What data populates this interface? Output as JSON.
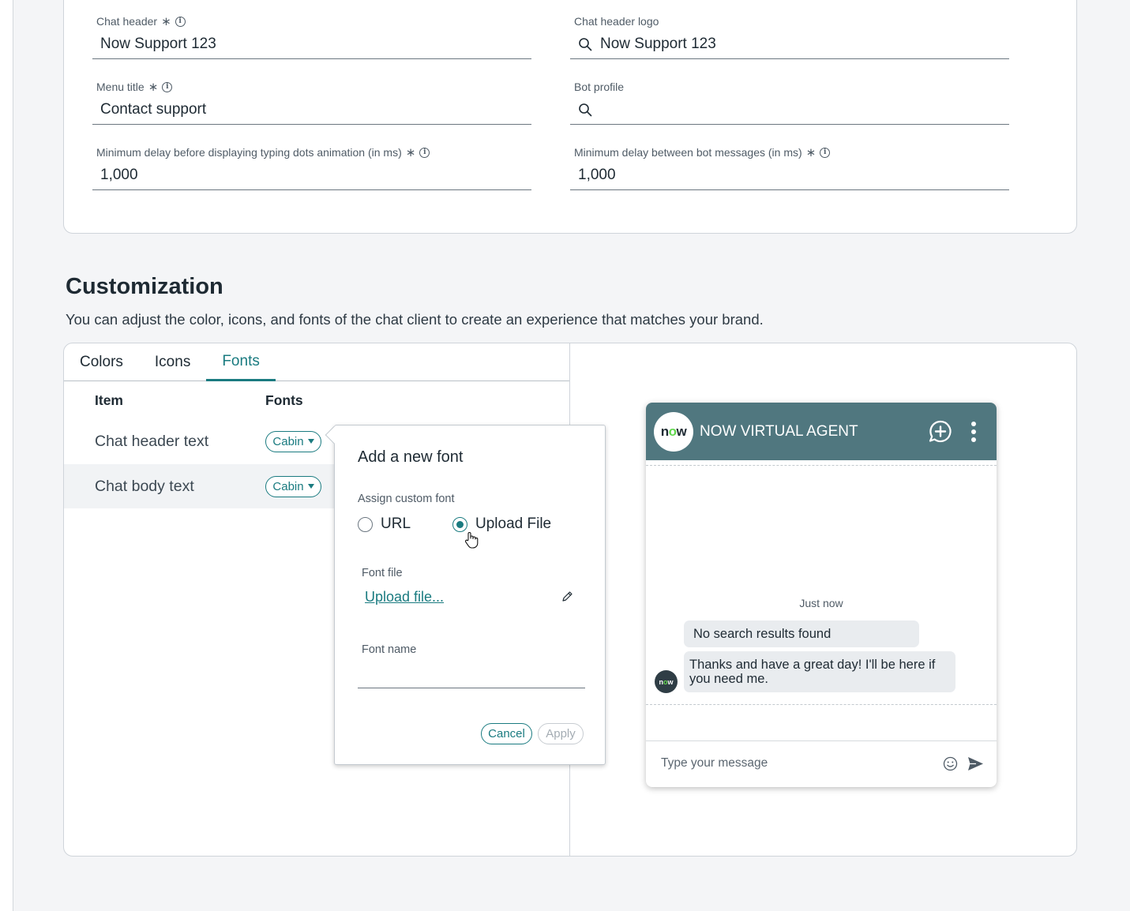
{
  "settings": {
    "chat_header": {
      "label": "Chat header",
      "value": "Now Support 123"
    },
    "chat_header_logo": {
      "label": "Chat header logo",
      "value": "Now Support 123"
    },
    "menu_title": {
      "label": "Menu title",
      "value": "Contact support"
    },
    "bot_profile": {
      "label": "Bot profile",
      "value": ""
    },
    "typing_delay": {
      "label": "Minimum delay before displaying typing dots animation (in ms)",
      "value": "1,000"
    },
    "bot_message_delay": {
      "label": "Minimum delay between bot messages (in ms)",
      "value": "1,000"
    },
    "required_marker": "∗",
    "info_glyph": "i"
  },
  "customization": {
    "title": "Customization",
    "description": "You can adjust the color, icons, and fonts of the chat client to create an experience that matches your brand.",
    "tabs": [
      {
        "label": "Colors",
        "active": false
      },
      {
        "label": "Icons",
        "active": false
      },
      {
        "label": "Fonts",
        "active": true
      }
    ],
    "columns": {
      "item": "Item",
      "fonts": "Fonts"
    },
    "rows": [
      {
        "item": "Chat header text",
        "font": "Cabin"
      },
      {
        "item": "Chat body text",
        "font": "Cabin"
      }
    ]
  },
  "popover": {
    "title": "Add a new font",
    "assign_label": "Assign custom font",
    "option_url": "URL",
    "option_upload": "Upload File",
    "selected": "upload",
    "font_file_label": "Font file",
    "upload_link": "Upload file...",
    "font_name_label": "Font name",
    "font_name_value": "",
    "cancel": "Cancel",
    "apply": "Apply"
  },
  "chat_preview": {
    "logo_text_pre": "n",
    "logo_text_o": "o",
    "logo_text_post": "w",
    "title": "NOW VIRTUAL AGENT",
    "timestamp": "Just now",
    "messages": [
      {
        "text": "No search results found"
      },
      {
        "text": "Thanks and have a great day! I'll be here if you need me."
      }
    ],
    "composer_placeholder": "Type your message"
  },
  "colors": {
    "accent": "#1a7b80",
    "chat_header_bg": "#50777f",
    "now_green": "#62d84e"
  }
}
